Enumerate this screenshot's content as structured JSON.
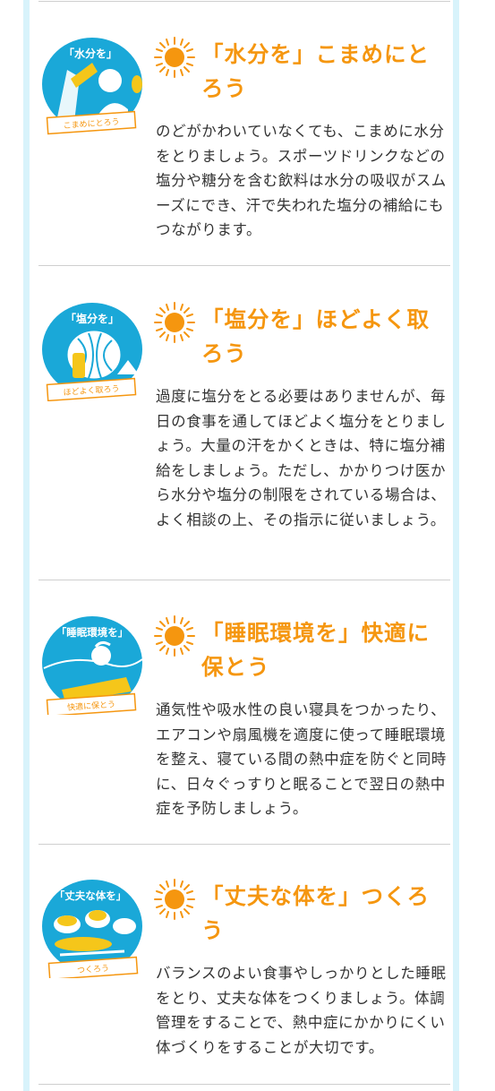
{
  "tips": [
    {
      "illustration_label": "「水分を」",
      "illustration_caption": "こまめにとろう",
      "title": "「水分を」こまめにとろう",
      "body": "のどがかわいていなくても、こまめに水分をとりましょう。スポーツドリンクなどの塩分や糖分を含む飲料は水分の吸収がスムーズにでき、汗で失われた塩分の補給にもつながります。"
    },
    {
      "illustration_label": "「塩分を」",
      "illustration_caption": "ほどよく取ろう",
      "title": "「塩分を」ほどよく取ろう",
      "body": "過度に塩分をとる必要はありませんが、毎日の食事を通してほどよく塩分をとりましょう。大量の汗をかくときは、特に塩分補給をしましょう。ただし、かかりつけ医から水分や塩分の制限をされている場合は、よく相談の上、その指示に従いましょう。"
    },
    {
      "illustration_label": "「睡眠環境を」",
      "illustration_caption": "快適に保とう",
      "title": "「睡眠環境を」快適に保とう",
      "body": "通気性や吸水性の良い寝具をつかったり、エアコンや扇風機を適度に使って睡眠環境を整え、寝ている間の熱中症を防ぐと同時に、日々ぐっすりと眠ることで翌日の熱中症を予防しましょう。"
    },
    {
      "illustration_label": "「丈夫な体を」",
      "illustration_caption": "つくろう",
      "title": "「丈夫な体を」つくろう",
      "body": "バランスのよい食事やしっかりとした睡眠をとり、丈夫な体をつくりましょう。体調管理をすることで、熱中症にかかりにくい体づくりをすることが大切です。"
    }
  ],
  "colors": {
    "accent_orange": "#f5960f",
    "illustration_blue": "#1aa8d8",
    "frame_light_blue": "#d8f3fb",
    "body_text": "#333333",
    "divider": "#cfcfcf"
  },
  "icons": [
    "sun-icon",
    "drink-illustration",
    "salt-illustration",
    "sleep-illustration",
    "meal-illustration"
  ]
}
